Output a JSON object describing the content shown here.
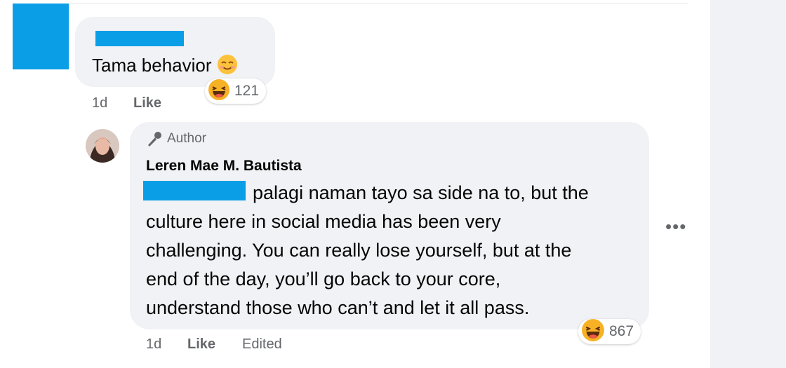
{
  "comment1": {
    "text": "Tama behavior",
    "reaction": {
      "icon": "laughing-emoji",
      "count": "121"
    },
    "time": "1d",
    "like_label": "Like"
  },
  "comment2": {
    "badge": "Author",
    "name": "Leren Mae M. Bautista",
    "line1": "palagi naman tayo sa side na to, but the",
    "line2": "culture here in social media has been very",
    "line3": "challenging. You can really lose yourself, but at the",
    "line4": "end of the day, you’ll go back to your core,",
    "line5": "understand those who can’t and let it all pass.",
    "reaction": {
      "icon": "laughing-emoji",
      "count": "867"
    },
    "time": "1d",
    "like_label": "Like",
    "edited_label": "Edited",
    "more_label": "•••"
  },
  "colors": {
    "redaction": "#0a9ee6",
    "bubble": "#f0f2f5",
    "muted": "#65676b"
  }
}
